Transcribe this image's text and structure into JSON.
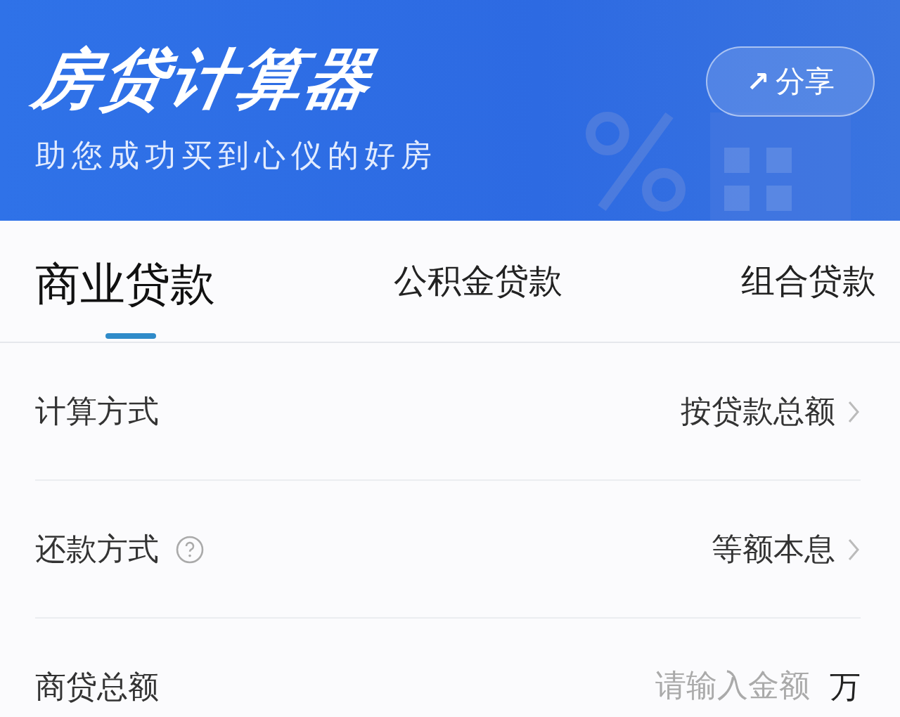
{
  "header": {
    "title": "房贷计算器",
    "subtitle": "助您成功买到心仪的好房",
    "share_button": {
      "icon": "↗",
      "label": "分享"
    }
  },
  "tabs": [
    {
      "label": "商业贷款",
      "selected": true
    },
    {
      "label": "公积金贷款",
      "selected": false
    },
    {
      "label": "组合贷款",
      "selected": false
    }
  ],
  "rows": [
    {
      "kind": "select",
      "label": "计算方式",
      "help": false,
      "value": "按贷款总额"
    },
    {
      "kind": "select",
      "label": "还款方式",
      "help": true,
      "value": "等额本息"
    },
    {
      "kind": "input",
      "label": "商贷总额",
      "placeholder": "请输入金额",
      "unit": "万"
    }
  ]
}
